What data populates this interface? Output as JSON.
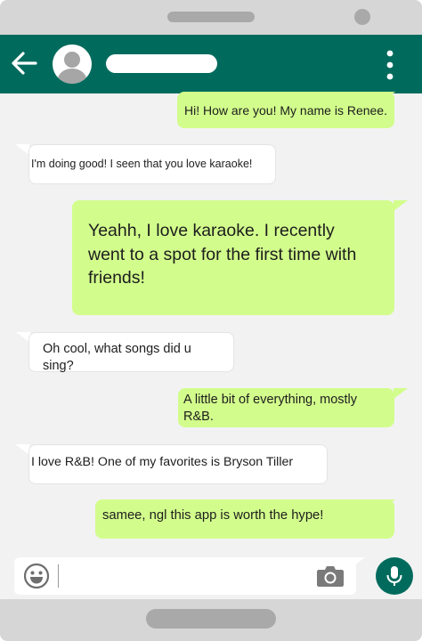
{
  "chat": {
    "messages": [
      {
        "direction": "outgoing",
        "text": "Hi! How are you! My name is Renee."
      },
      {
        "direction": "incoming",
        "text": "I'm doing good! I seen that you love karaoke!"
      },
      {
        "direction": "outgoing",
        "text": "Yeahh, I love karaoke. I recently went to a spot for the first time with friends!"
      },
      {
        "direction": "incoming",
        "text": "Oh cool, what songs did u sing?"
      },
      {
        "direction": "outgoing",
        "text": "A little bit of everything, mostly R&B."
      },
      {
        "direction": "incoming",
        "text": "I love R&B! One of my favorites is Bryson Tiller"
      },
      {
        "direction": "outgoing",
        "text": "samee, ngl this app is worth the hype!"
      }
    ]
  },
  "icons": {
    "back": "arrow-left-icon",
    "avatar": "user-avatar-icon",
    "menu": "more-vertical-icon",
    "emoji": "emoji-smile-icon",
    "camera": "camera-icon",
    "mic": "microphone-icon"
  },
  "colors": {
    "header": "#006b5d",
    "outgoing_bubble": "#d2fd8c",
    "incoming_bubble": "#ffffff",
    "chat_background": "#f2f2f2",
    "phone_frame": "#d6d6d6"
  }
}
